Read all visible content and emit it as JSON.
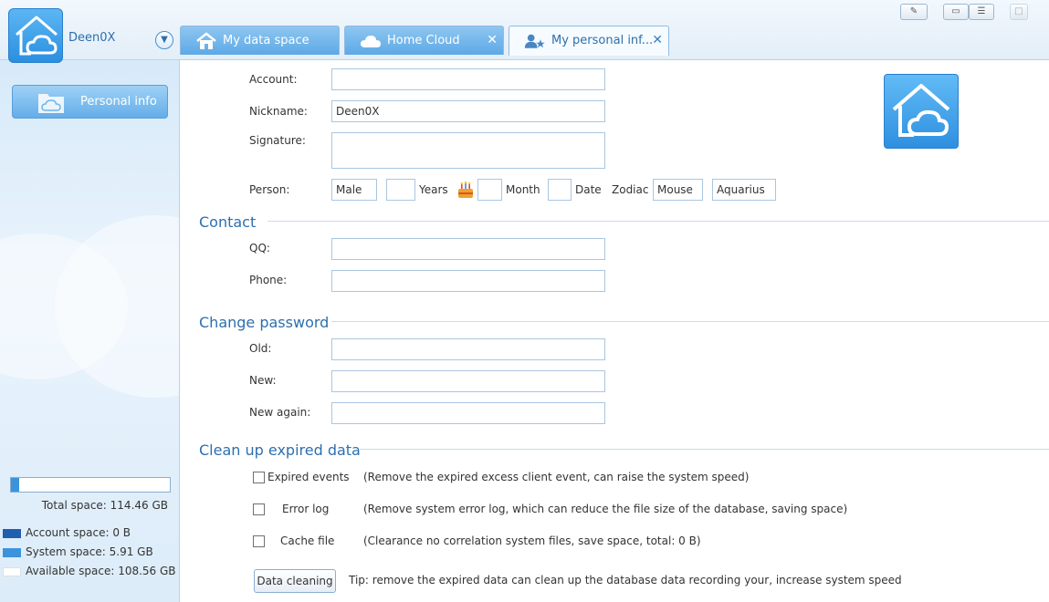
{
  "header": {
    "username": "Deen0X",
    "tabs": [
      {
        "label": "My data space",
        "icon": "home-icon"
      },
      {
        "label": "Home Cloud",
        "icon": "cloud-icon"
      },
      {
        "label": "My personal inf...",
        "icon": "user-star-icon"
      }
    ],
    "close_glyph": "✕",
    "menu_glyph": "▼"
  },
  "sidebar": {
    "nav": {
      "label": "Personal info",
      "icon": "folder-cloud-icon"
    },
    "storage": {
      "used_fraction": 0.052,
      "total": "Total space: 114.46 GB",
      "legend": [
        {
          "text": "Account space: 0 B",
          "color": "#1f5fae"
        },
        {
          "text": "System space: 5.91 GB",
          "color": "#3c93dc"
        },
        {
          "text": "Available space: 108.56 GB",
          "color": "#ffffff"
        }
      ]
    }
  },
  "personal": {
    "account_label": "Account:",
    "account_value": "",
    "nickname_label": "Nickname:",
    "nickname_value": "Deen0X",
    "signature_label": "Signature:",
    "signature_value": "",
    "person_label": "Person:",
    "gender": "Male",
    "years_value": "",
    "years_label": "Years",
    "month_value": "",
    "month_label": "Month",
    "date_value": "",
    "date_label": "Date",
    "zodiac_label": "Zodiac",
    "zodiac": "Mouse",
    "star_sign": "Aquarius"
  },
  "contact": {
    "title": "Contact",
    "qq_label": "QQ:",
    "qq_value": "",
    "phone_label": "Phone:",
    "phone_value": ""
  },
  "password": {
    "title": "Change password",
    "old_label": "Old:",
    "new_label": "New:",
    "new_again_label": "New again:"
  },
  "cleanup": {
    "title": "Clean up expired data",
    "items": [
      {
        "label": "Expired events",
        "desc": "(Remove the expired excess client event, can raise the system speed)"
      },
      {
        "label": "Error log",
        "desc": "(Remove system error log, which can reduce the file size of the database, saving space)"
      },
      {
        "label": "Cache file",
        "desc": "(Clearance no correlation system files, save space, total: 0 B)"
      }
    ],
    "button_label": "Data cleaning",
    "tip": "Tip: remove the expired data can clean up the database data recording your, increase system speed"
  },
  "colors": {
    "accent": "#2d6fae",
    "tab_active_bg": "#f6fbff",
    "tab_bg": "#6fb4ea",
    "logo_bg": "#3c9be6"
  }
}
